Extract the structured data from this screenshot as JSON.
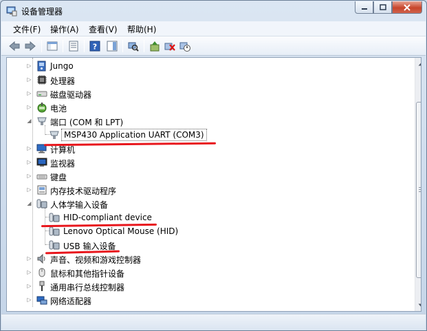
{
  "window": {
    "title": "设备管理器"
  },
  "menu": [
    {
      "id": "file",
      "label": "文件(F)"
    },
    {
      "id": "action",
      "label": "操作(A)"
    },
    {
      "id": "view",
      "label": "查看(V)"
    },
    {
      "id": "help",
      "label": "帮助(H)"
    }
  ],
  "tree": {
    "jungo": "Jungo",
    "processors": "处理器",
    "disk_drives": "磁盘驱动器",
    "battery": "电池",
    "ports": "端口 (COM 和 LPT)",
    "msp430": "MSP430 Application UART (COM3)",
    "computer": "计算机",
    "monitors": "监视器",
    "keyboards": "键盘",
    "memory_tech": "内存技术驱动程序",
    "hid": "人体学输入设备",
    "hid_compliant": "HID-compliant device",
    "lenovo_mouse": "Lenovo Optical Mouse (HID)",
    "usb_input": "USB 输入设备",
    "audio": "声音、视频和游戏控制器",
    "mice": "鼠标和其他指针设备",
    "usb_controllers": "通用串行总线控制器",
    "network": "网络适配器"
  },
  "colors": {
    "annotation": "#e8161c",
    "accent": "#1f5fa8"
  }
}
